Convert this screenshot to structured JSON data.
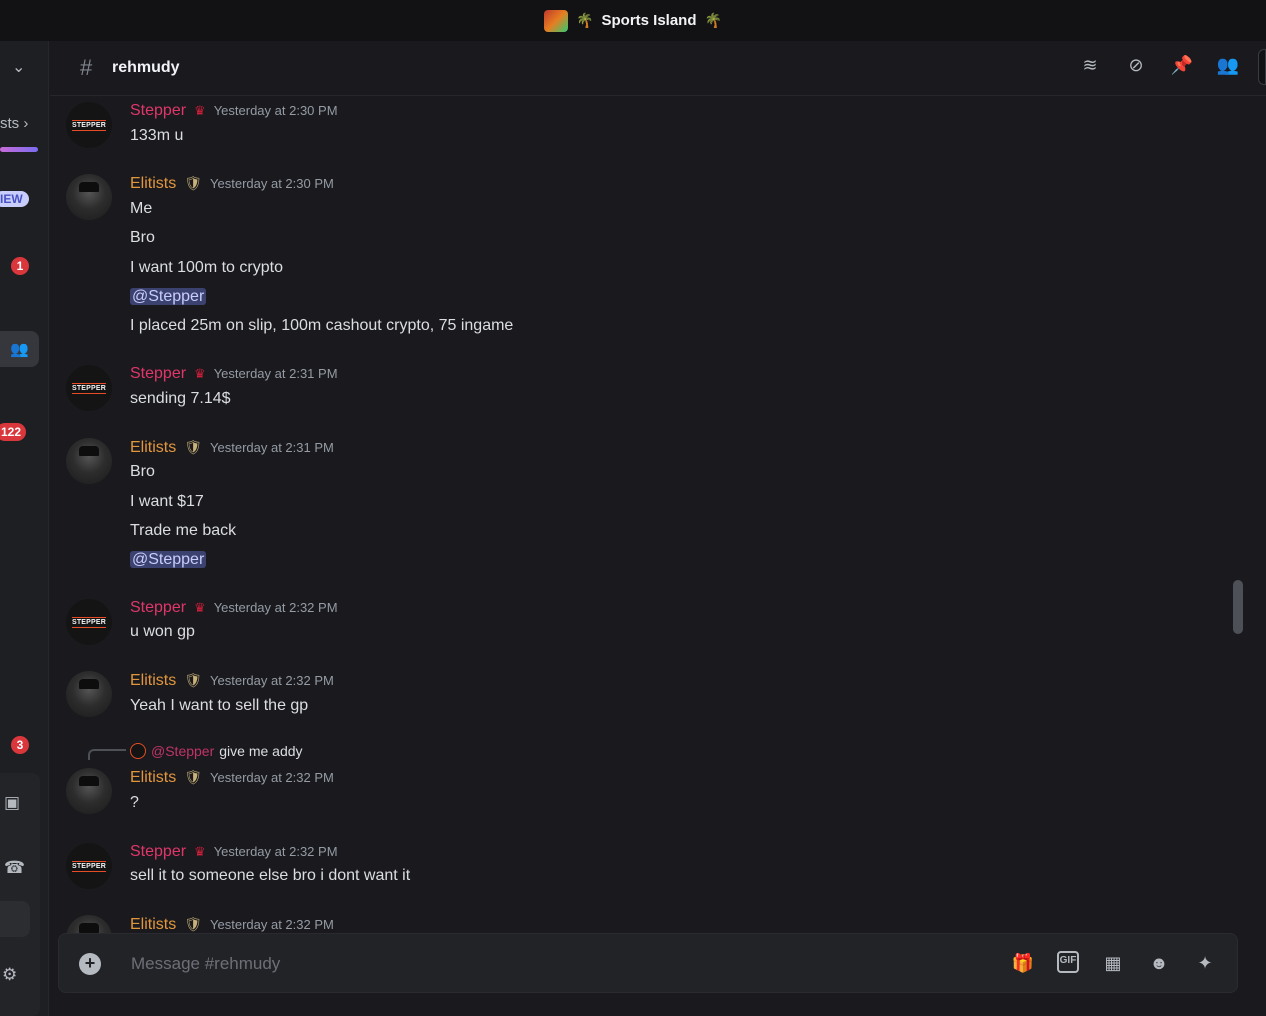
{
  "titlebar": {
    "server_name": "Sports Island",
    "palm_left": "🌴",
    "palm_right": "🌴"
  },
  "sidebar": {
    "partial_text": "sts",
    "new_badge": "IEW",
    "badge_1": "1",
    "badge_2": "122",
    "badge_3": "3"
  },
  "header": {
    "channel_name": "rehmudy",
    "icons": [
      "threads-icon",
      "mute-icon",
      "pin-icon",
      "members-icon"
    ]
  },
  "messages": [
    {
      "author": "Stepper",
      "badge": "crown",
      "timestamp": "Yesterday at 2:30 PM",
      "lines": [
        "133m u"
      ]
    },
    {
      "author": "Elitists",
      "badge": "shield",
      "timestamp": "Yesterday at 2:30 PM",
      "lines": [
        "Me",
        "Bro",
        "I want 100m to crypto",
        "@Stepper",
        "I placed 25m on slip, 100m cashout crypto, 75 ingame"
      ]
    },
    {
      "author": "Stepper",
      "badge": "crown",
      "timestamp": "Yesterday at 2:31 PM",
      "lines": [
        "sending 7.14$"
      ]
    },
    {
      "author": "Elitists",
      "badge": "shield",
      "timestamp": "Yesterday at 2:31 PM",
      "lines": [
        "Bro",
        "I want $17",
        "Trade me back",
        "@Stepper"
      ]
    },
    {
      "author": "Stepper",
      "badge": "crown",
      "timestamp": "Yesterday at 2:32 PM",
      "lines": [
        "u won gp"
      ]
    },
    {
      "author": "Elitists",
      "badge": "shield",
      "timestamp": "Yesterday at 2:32 PM",
      "lines": [
        "Yeah I want to sell the gp"
      ]
    },
    {
      "author": "Elitists",
      "badge": "shield",
      "timestamp": "Yesterday at 2:32 PM",
      "reply": {
        "author": "@Stepper",
        "text": "give me addy"
      },
      "lines": [
        "?"
      ]
    },
    {
      "author": "Stepper",
      "badge": "crown",
      "timestamp": "Yesterday at 2:32 PM",
      "lines": [
        "sell it to someone else bro i dont want it"
      ]
    },
    {
      "author": "Elitists",
      "badge": "shield",
      "timestamp": "Yesterday at 2:32 PM",
      "lines": []
    }
  ],
  "avatar_label": "STEPPER",
  "composer": {
    "placeholder": "Message #rehmudy",
    "gif_label": "GIF"
  },
  "colors": {
    "stepper": "#e0366a",
    "elitists": "#e2963c",
    "mention_bg": "#3c4270",
    "background": "#1a1a1e"
  }
}
